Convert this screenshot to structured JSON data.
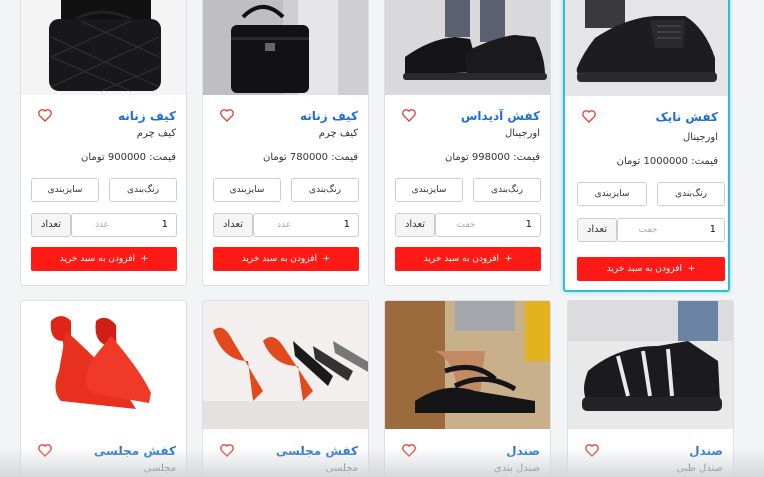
{
  "colors": {
    "accent": "#1d6fd6",
    "button": "#ff1a16",
    "active_border": "#2bc1d4",
    "heart": "#e2403a"
  },
  "common": {
    "color_label": "رنگ‌بندی",
    "size_label": "سایزبندی",
    "qty_label": "تعداد",
    "add_to_cart": "افزودن به سبد خرید",
    "plus": "+"
  },
  "products": [
    {
      "title": "کفش نایک",
      "subtitle": "اورجینال",
      "price": "قیمت: 1000000 تومان",
      "qty": "1",
      "unit": "جفت"
    },
    {
      "title": "کفش آدیداس",
      "subtitle": "اورجینال",
      "price": "قیمت: 998000 تومان",
      "qty": "1",
      "unit": "جفت"
    },
    {
      "title": "کیف زنانه",
      "subtitle": "کیف چرم",
      "price": "قیمت: 780000 تومان",
      "qty": "1",
      "unit": "عدد"
    },
    {
      "title": "کیف زنانه",
      "subtitle": "کیف چرم",
      "price": "قیمت: 900000 تومان",
      "qty": "1",
      "unit": "عدد"
    },
    {
      "title": "صندل",
      "subtitle": "صندل طبی"
    },
    {
      "title": "صندل",
      "subtitle": "صندل بندی"
    },
    {
      "title": "کفش مجلسی",
      "subtitle": "مجلسی"
    },
    {
      "title": "کفش مجلسی",
      "subtitle": "مجلسی"
    }
  ]
}
